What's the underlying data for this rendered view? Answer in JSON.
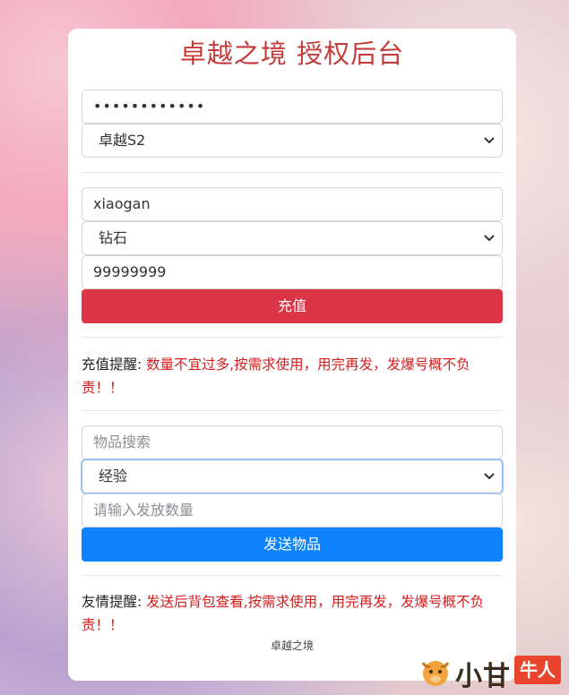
{
  "title": "卓越之境 授权后台",
  "auth": {
    "password_value": "••••••••••••",
    "server_select": "卓越S2"
  },
  "recharge": {
    "account_value": "xiaogan",
    "currency_select": "钻石",
    "amount_value": "99999999",
    "button_label": "充值",
    "notice_label": "充值提醒:",
    "notice_text": "数量不宜过多,按需求使用，用完再发，发爆号概不负责！！"
  },
  "item": {
    "search_placeholder": "物品搜索",
    "item_select": "经验",
    "quantity_placeholder": "请输入发放数量",
    "button_label": "发送物品",
    "notice_label": "友情提醒:",
    "notice_text": "发送后背包查看,按需求使用，用完再发，发爆号概不负责！！"
  },
  "footer": "卓越之境",
  "watermark": {
    "text": "小甘",
    "badge": "牛人"
  },
  "colors": {
    "title": "#c33c3c",
    "recharge_button": "#dc3545",
    "send_button": "#0d83fd",
    "notice_text": "#d21e1e"
  }
}
